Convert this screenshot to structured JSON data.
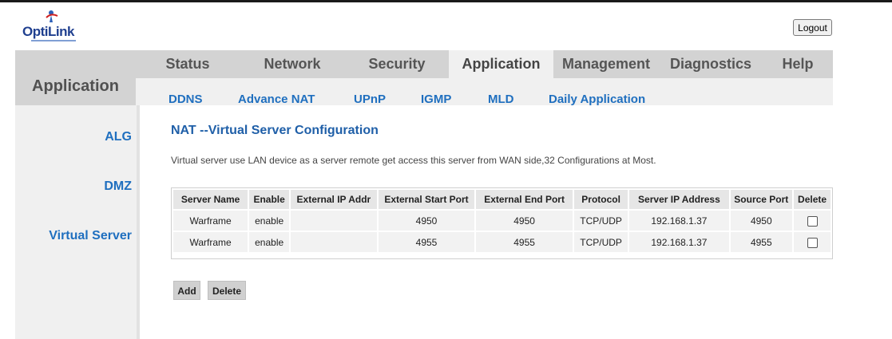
{
  "logo": {
    "text": "OptiLink",
    "icon": "optilink-figure-icon"
  },
  "header": {
    "logout_label": "Logout"
  },
  "nav": {
    "section_title": "Application",
    "tabs": [
      {
        "label": "Status"
      },
      {
        "label": "Network"
      },
      {
        "label": "Security"
      },
      {
        "label": "Application",
        "active": true
      },
      {
        "label": "Management"
      },
      {
        "label": "Diagnostics"
      },
      {
        "label": "Help"
      }
    ]
  },
  "subnav": {
    "items": [
      {
        "label": "DDNS"
      },
      {
        "label": "Advance NAT"
      },
      {
        "label": "UPnP"
      },
      {
        "label": "IGMP"
      },
      {
        "label": "MLD"
      },
      {
        "label": "Daily Application"
      }
    ]
  },
  "sidebar": {
    "items": [
      {
        "label": "ALG"
      },
      {
        "label": "DMZ"
      },
      {
        "label": "Virtual Server",
        "active": true
      }
    ]
  },
  "main": {
    "title": "NAT --Virtual Server Configuration",
    "description": "Virtual server use LAN device as a server remote get access this server from WAN side,32 Configurations at Most.",
    "table": {
      "headers": [
        "Server Name",
        "Enable",
        "External IP Addr",
        "External Start Port",
        "External End Port",
        "Protocol",
        "Server IP Address",
        "Source Port",
        "Delete"
      ],
      "rows": [
        [
          "Warframe",
          "enable",
          "",
          "4950",
          "4950",
          "TCP/UDP",
          "192.168.1.37",
          "4950"
        ],
        [
          "Warframe",
          "enable",
          "",
          "4955",
          "4955",
          "TCP/UDP",
          "192.168.1.37",
          "4955"
        ]
      ]
    },
    "add_label": "Add",
    "delete_label": "Delete"
  },
  "colors": {
    "nav_bg": "#d3d3d3",
    "subnav_bg": "#f0f0f0",
    "link_blue": "#1f6fbf",
    "title_blue": "#1f5fa8"
  }
}
